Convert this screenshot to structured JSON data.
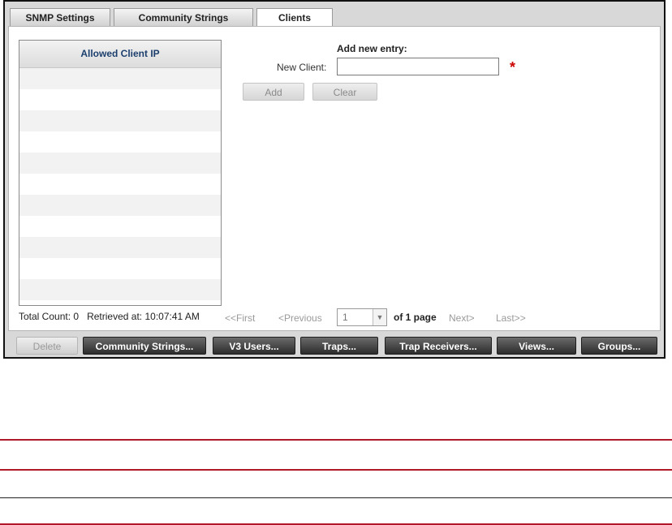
{
  "tabs": [
    {
      "label": "SNMP Settings",
      "active": false
    },
    {
      "label": "Community Strings",
      "active": false
    },
    {
      "label": "Clients",
      "active": true
    }
  ],
  "grid": {
    "header": "Allowed Client IP",
    "rows": []
  },
  "entry": {
    "title": "Add new entry:",
    "label": "New Client:",
    "value": "",
    "required_marker": "*",
    "add_label": "Add",
    "clear_label": "Clear"
  },
  "status": {
    "total_count_label": "Total Count:",
    "total_count": "0",
    "retrieved_label": "Retrieved at:",
    "retrieved_time": "10:07:41 AM"
  },
  "pager": {
    "first": "<<First",
    "previous": "<Previous",
    "page": "1",
    "of_label": "of 1 page",
    "next": "Next>",
    "last": "Last>>"
  },
  "buttons": {
    "delete": "Delete",
    "community_strings": "Community Strings...",
    "v3_users": "V3 Users...",
    "traps": "Traps...",
    "trap_receivers": "Trap Receivers...",
    "views": "Views...",
    "groups": "Groups..."
  },
  "colors": {
    "accent_red": "#b0192a",
    "required_red": "#cc0000",
    "header_text": "#1c3f6e"
  }
}
